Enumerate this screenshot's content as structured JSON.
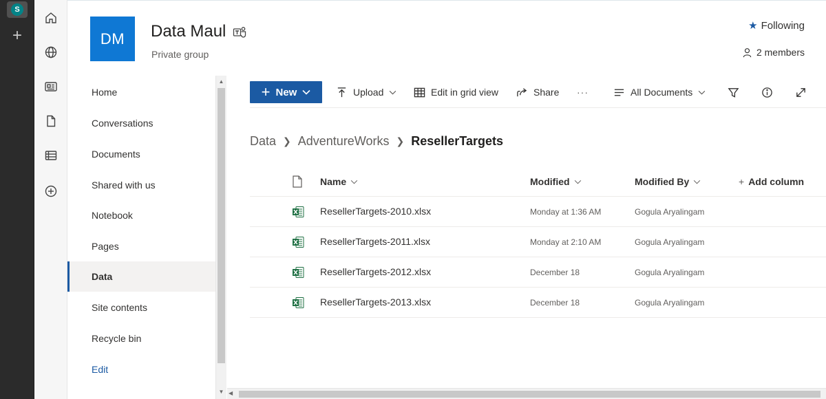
{
  "appbar": {
    "logo_letter": "S",
    "add_glyph": "+"
  },
  "rail": {
    "icons": [
      "home-icon",
      "globe-icon",
      "news-icon",
      "file-icon",
      "list-icon",
      "add-circle-icon"
    ]
  },
  "header": {
    "logo_initials": "DM",
    "title": "Data Maul",
    "subtitle": "Private group",
    "following_label": "Following",
    "members_label": "2 members",
    "brand_color": "#0f78d4"
  },
  "nav": {
    "items": [
      {
        "label": "Home"
      },
      {
        "label": "Conversations"
      },
      {
        "label": "Documents"
      },
      {
        "label": "Shared with us"
      },
      {
        "label": "Notebook"
      },
      {
        "label": "Pages"
      },
      {
        "label": "Data",
        "active": true
      },
      {
        "label": "Site contents"
      },
      {
        "label": "Recycle bin"
      },
      {
        "label": "Edit"
      }
    ]
  },
  "commands": {
    "new_label": "New",
    "upload_label": "Upload",
    "grid_label": "Edit in grid view",
    "share_label": "Share",
    "more_glyph": "···",
    "view_label": "All Documents",
    "accent": "#1b5aa3"
  },
  "breadcrumb": {
    "items": [
      "Data",
      "AdventureWorks"
    ],
    "current": "ResellerTargets"
  },
  "table": {
    "columns": {
      "name": "Name",
      "modified": "Modified",
      "modified_by": "Modified By",
      "add_column": "Add column"
    },
    "rows": [
      {
        "name": "ResellerTargets-2010.xlsx",
        "modified": "Monday at 1:36 AM",
        "modified_by": "Gogula Aryalingam"
      },
      {
        "name": "ResellerTargets-2011.xlsx",
        "modified": "Monday at 2:10 AM",
        "modified_by": "Gogula Aryalingam"
      },
      {
        "name": "ResellerTargets-2012.xlsx",
        "modified": "December 18",
        "modified_by": "Gogula Aryalingam"
      },
      {
        "name": "ResellerTargets-2013.xlsx",
        "modified": "December 18",
        "modified_by": "Gogula Aryalingam"
      }
    ]
  }
}
